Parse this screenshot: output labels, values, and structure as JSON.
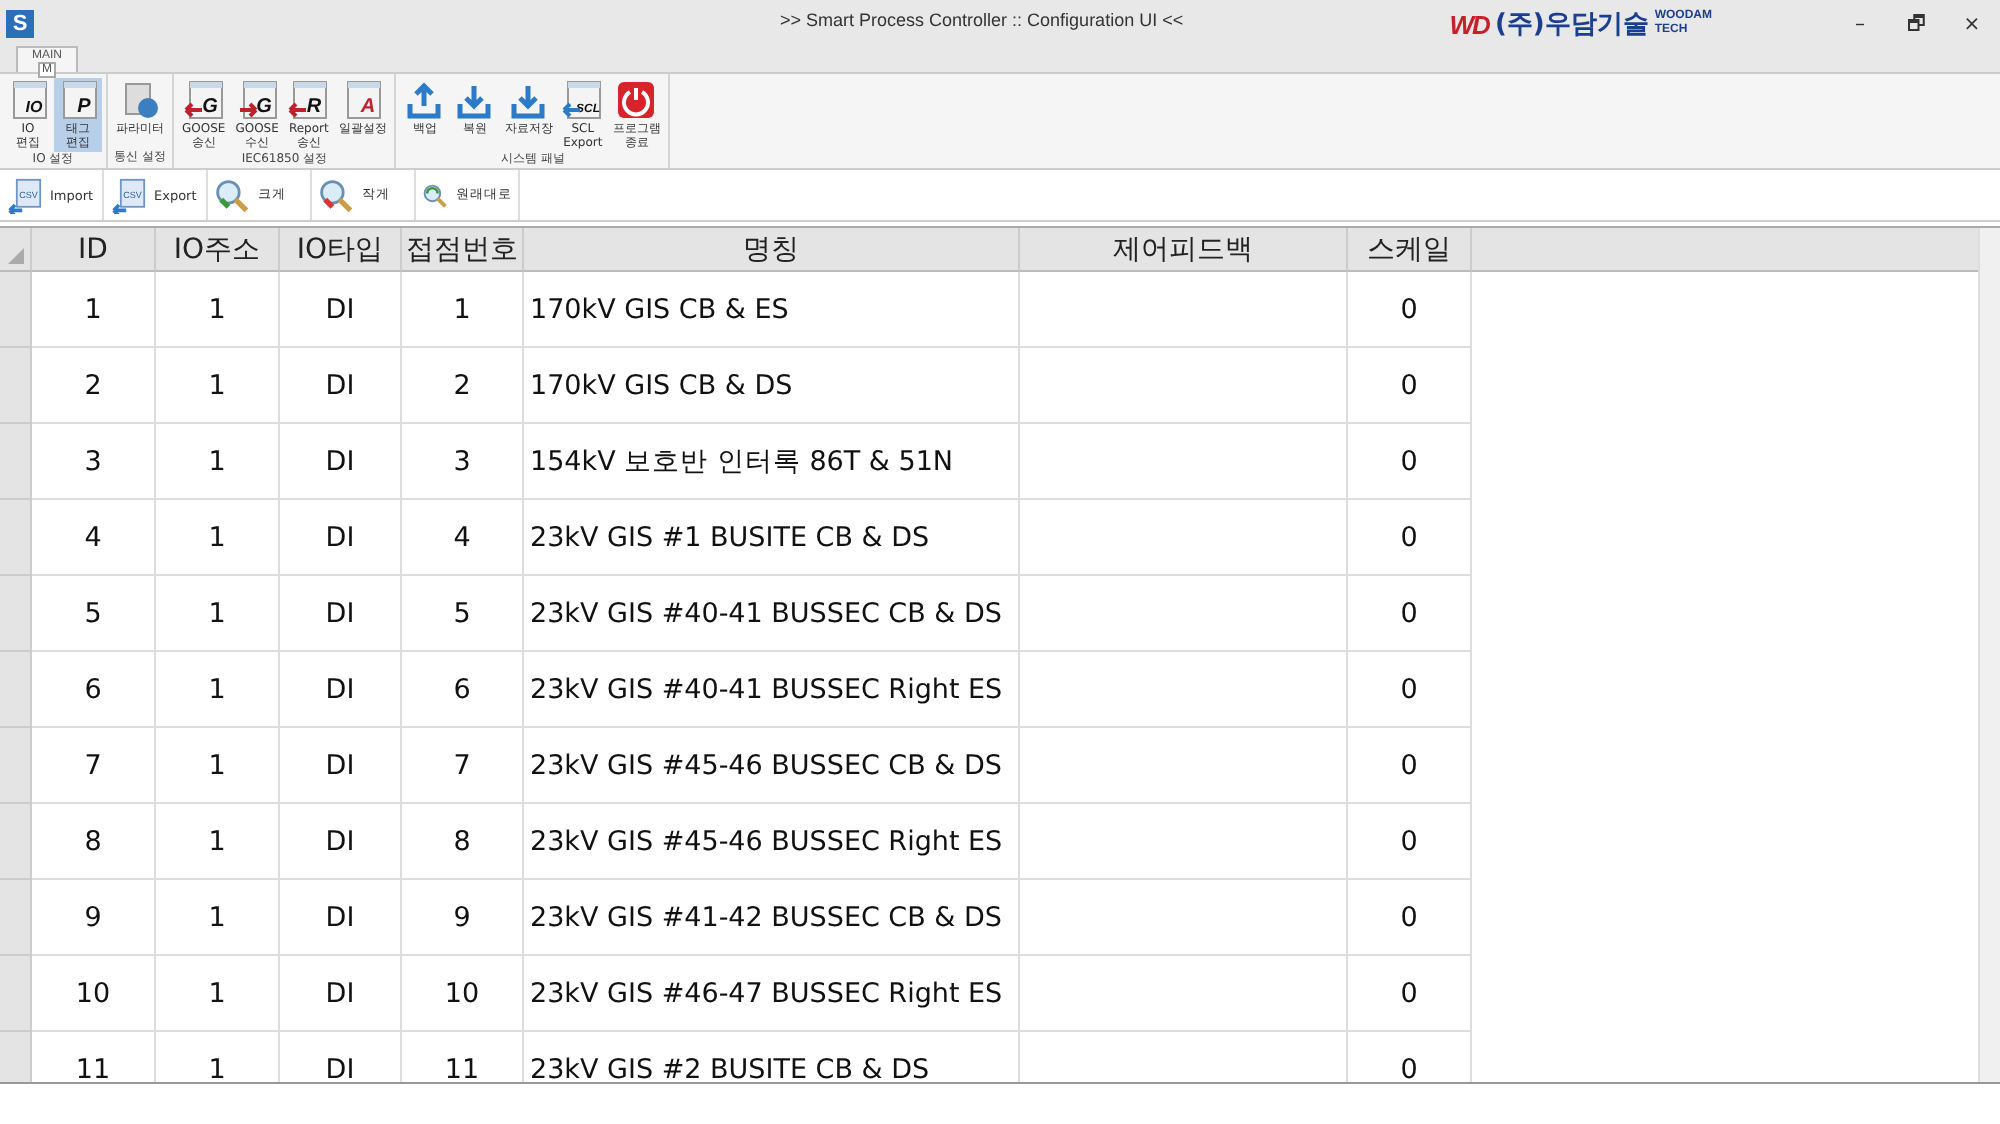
{
  "window": {
    "app_icon": "S",
    "title": ">> Smart Process Controller :: Configuration UI <<",
    "logo": {
      "mark": "WD",
      "name": "(주)우담기술",
      "sub_top": "WOODAM",
      "sub_bottom": "TECH"
    },
    "controls": [
      "–",
      "🗗",
      "×"
    ]
  },
  "ribbon_tab": {
    "label": "MAIN",
    "key": "M",
    "selected": true
  },
  "ribbon_groups": [
    {
      "label": "IO 설정",
      "buttons": [
        {
          "label": "IO\n편집",
          "kind": "doc",
          "glyph": "IO",
          "selected": false
        },
        {
          "label": "태그\n편집",
          "kind": "doc",
          "glyph": "P",
          "selected": true
        }
      ]
    },
    {
      "label": "통신 설정",
      "buttons": [
        {
          "label": "파라미터",
          "kind": "param",
          "selected": false
        }
      ]
    },
    {
      "label": "IEC61850 설정",
      "buttons": [
        {
          "label": "GOOSE\n송신",
          "kind": "send",
          "glyph": "G",
          "selected": false
        },
        {
          "label": "GOOSE\n수신",
          "kind": "recv",
          "glyph": "G",
          "selected": false
        },
        {
          "label": "Report\n송신",
          "kind": "send",
          "glyph": "R",
          "selected": false
        },
        {
          "label": "일괄설정",
          "kind": "batch",
          "glyph": "A",
          "selected": false
        }
      ]
    },
    {
      "label": "시스템 패널",
      "buttons": [
        {
          "label": "백업",
          "kind": "upload",
          "selected": false
        },
        {
          "label": "복원",
          "kind": "download",
          "selected": false
        },
        {
          "label": "자료저장",
          "kind": "save",
          "selected": false
        },
        {
          "label": "SCL\nExport",
          "kind": "scl",
          "glyph": "SCL",
          "selected": false
        },
        {
          "label": "프로그램\n종료",
          "kind": "power",
          "selected": false
        }
      ]
    }
  ],
  "toolbar": [
    {
      "label": "Import",
      "kind": "csv",
      "glyph": "CSV"
    },
    {
      "label": "Export",
      "kind": "csv",
      "glyph": "CSV"
    },
    {
      "label": "크게",
      "kind": "zoom-in"
    },
    {
      "label": "작게",
      "kind": "zoom-out"
    },
    {
      "label": "원래대로",
      "kind": "zoom-reset"
    }
  ],
  "table": {
    "columns": [
      "ID",
      "IO주소",
      "IO타입",
      "접점번호",
      "명칭",
      "제어피드백",
      "스케일"
    ],
    "rows": [
      [
        "1",
        "1",
        "DI",
        "1",
        "170kV GIS CB & ES",
        "",
        "0"
      ],
      [
        "2",
        "1",
        "DI",
        "2",
        "170kV GIS CB & DS",
        "",
        "0"
      ],
      [
        "3",
        "1",
        "DI",
        "3",
        "154kV 보호반 인터록 86T & 51N",
        "",
        "0"
      ],
      [
        "4",
        "1",
        "DI",
        "4",
        "23kV GIS #1 BUSITE CB & DS",
        "",
        "0"
      ],
      [
        "5",
        "1",
        "DI",
        "5",
        "23kV GIS #40-41 BUSSEC CB & DS",
        "",
        "0"
      ],
      [
        "6",
        "1",
        "DI",
        "6",
        "23kV GIS #40-41 BUSSEC Right ES",
        "",
        "0"
      ],
      [
        "7",
        "1",
        "DI",
        "7",
        "23kV GIS #45-46 BUSSEC CB & DS",
        "",
        "0"
      ],
      [
        "8",
        "1",
        "DI",
        "8",
        "23kV GIS #45-46 BUSSEC Right ES",
        "",
        "0"
      ],
      [
        "9",
        "1",
        "DI",
        "9",
        "23kV GIS #41-42 BUSSEC CB & DS",
        "",
        "0"
      ],
      [
        "10",
        "1",
        "DI",
        "10",
        "23kV GIS #46-47 BUSSEC Right ES",
        "",
        "0"
      ],
      [
        "11",
        "1",
        "DI",
        "11",
        "23kV GIS #2 BUSITE CB & DS",
        "",
        "0"
      ]
    ]
  }
}
